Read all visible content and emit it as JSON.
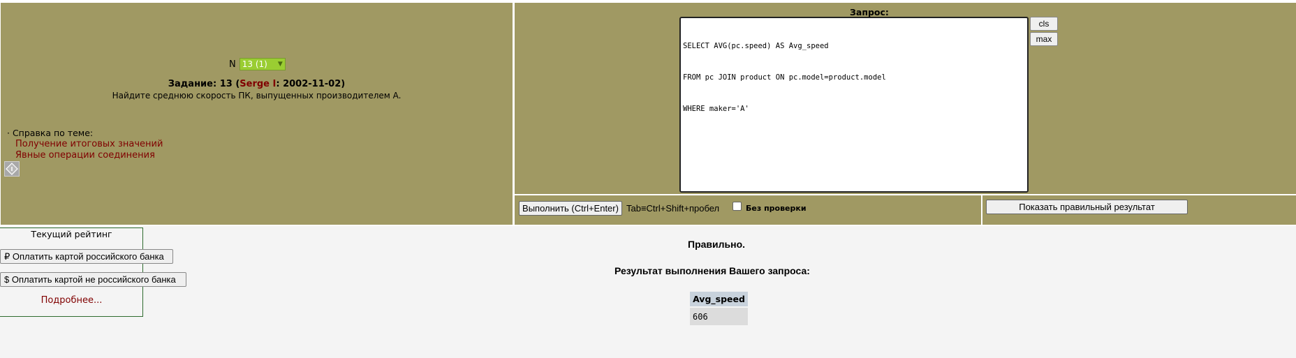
{
  "task_selector": {
    "label": "N",
    "selected": "13 (1)"
  },
  "task": {
    "prefix": "Задание: 13 (",
    "author": "Serge I",
    "suffix": ": 2002-11-02)",
    "text": "Найдите среднюю скорость ПК, выпущенных производителем A."
  },
  "help": {
    "heading": "· Справка по теме:",
    "links": [
      "Получение итоговых значений",
      "Явные операции соединения"
    ]
  },
  "query": {
    "label": "Запрос:",
    "lines": [
      "SELECT AVG(pc.speed) AS Avg_speed",
      "FROM pc JOIN product ON pc.model=product.model",
      "WHERE maker='A'"
    ],
    "cls_label": "cls",
    "max_label": "max"
  },
  "exec_bar": {
    "execute_label": "Выполнить (Ctrl+Enter)",
    "hint": "Tab≡Ctrl+Shift+пробел",
    "no_check_label": "Без  проверки",
    "no_check_checked": false
  },
  "show_result_label": "Показать правильный результат",
  "rating": {
    "title": "Текущий рейтинг",
    "pay_ru": "₽ Оплатить картой российского банка",
    "pay_foreign": "$ Оплатить картой не российского банка",
    "more": "Подробнее..."
  },
  "result": {
    "status": "Правильно.",
    "title": "Результат выполнения Вашего запроса:",
    "columns": [
      "Avg_speed"
    ],
    "rows": [
      [
        "606"
      ]
    ]
  },
  "colors": {
    "panel_bg": "#a09963",
    "link": "#800000",
    "selector_bg": "#9acd32"
  }
}
